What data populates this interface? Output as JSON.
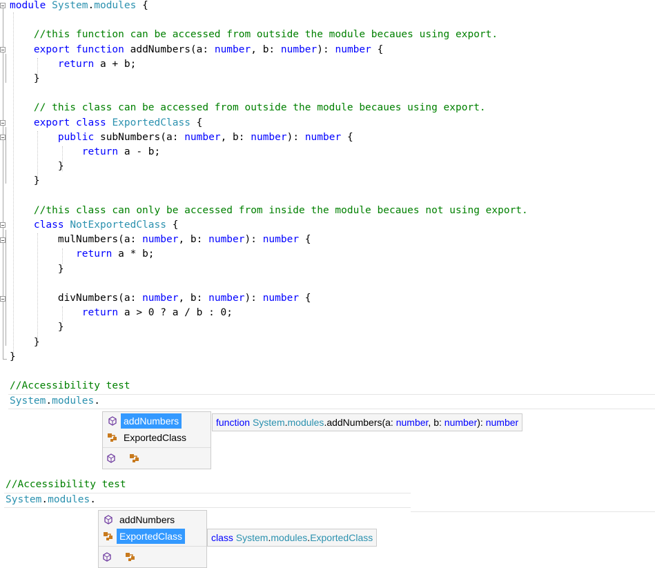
{
  "editor": {
    "lines": [
      [
        {
          "t": "module ",
          "c": "kw"
        },
        {
          "t": "System",
          "c": "ty"
        },
        {
          "t": ".",
          "c": "tx"
        },
        {
          "t": "modules",
          "c": "ty"
        },
        {
          "t": " {",
          "c": "tx"
        }
      ],
      [],
      [
        {
          "t": "    //this function can be accessed from outside the module becaues using export.",
          "c": "cm"
        }
      ],
      [
        {
          "t": "    ",
          "c": "tx"
        },
        {
          "t": "export",
          "c": "kw"
        },
        {
          "t": " ",
          "c": "tx"
        },
        {
          "t": "function",
          "c": "kw"
        },
        {
          "t": " addNumbers(a: ",
          "c": "tx"
        },
        {
          "t": "number",
          "c": "kw"
        },
        {
          "t": ", b: ",
          "c": "tx"
        },
        {
          "t": "number",
          "c": "kw"
        },
        {
          "t": "): ",
          "c": "tx"
        },
        {
          "t": "number",
          "c": "kw"
        },
        {
          "t": " {",
          "c": "tx"
        }
      ],
      [
        {
          "t": "        ",
          "c": "tx"
        },
        {
          "t": "return",
          "c": "kw"
        },
        {
          "t": " a + b;",
          "c": "tx"
        }
      ],
      [
        {
          "t": "    }",
          "c": "tx"
        }
      ],
      [],
      [
        {
          "t": "    // this class can be accessed from outside the module becaues using export.",
          "c": "cm"
        }
      ],
      [
        {
          "t": "    ",
          "c": "tx"
        },
        {
          "t": "export",
          "c": "kw"
        },
        {
          "t": " ",
          "c": "tx"
        },
        {
          "t": "class",
          "c": "kw"
        },
        {
          "t": " ",
          "c": "tx"
        },
        {
          "t": "ExportedClass",
          "c": "ty"
        },
        {
          "t": " {",
          "c": "tx"
        }
      ],
      [
        {
          "t": "        ",
          "c": "tx"
        },
        {
          "t": "public",
          "c": "kw"
        },
        {
          "t": " subNumbers(a: ",
          "c": "tx"
        },
        {
          "t": "number",
          "c": "kw"
        },
        {
          "t": ", b: ",
          "c": "tx"
        },
        {
          "t": "number",
          "c": "kw"
        },
        {
          "t": "): ",
          "c": "tx"
        },
        {
          "t": "number",
          "c": "kw"
        },
        {
          "t": " {",
          "c": "tx"
        }
      ],
      [
        {
          "t": "            ",
          "c": "tx"
        },
        {
          "t": "return",
          "c": "kw"
        },
        {
          "t": " a - b;",
          "c": "tx"
        }
      ],
      [
        {
          "t": "        }",
          "c": "tx"
        }
      ],
      [
        {
          "t": "    }",
          "c": "tx"
        }
      ],
      [],
      [
        {
          "t": "    //this class can only be accessed from inside the module becaues not using export.",
          "c": "cm"
        }
      ],
      [
        {
          "t": "    ",
          "c": "tx"
        },
        {
          "t": "class",
          "c": "kw"
        },
        {
          "t": " ",
          "c": "tx"
        },
        {
          "t": "NotExportedClass",
          "c": "ty"
        },
        {
          "t": " {",
          "c": "tx"
        }
      ],
      [
        {
          "t": "        mulNumbers(a: ",
          "c": "tx"
        },
        {
          "t": "number",
          "c": "kw"
        },
        {
          "t": ", b: ",
          "c": "tx"
        },
        {
          "t": "number",
          "c": "kw"
        },
        {
          "t": "): ",
          "c": "tx"
        },
        {
          "t": "number",
          "c": "kw"
        },
        {
          "t": " {",
          "c": "tx"
        }
      ],
      [
        {
          "t": "           ",
          "c": "tx"
        },
        {
          "t": "return",
          "c": "kw"
        },
        {
          "t": " a * b;",
          "c": "tx"
        }
      ],
      [
        {
          "t": "        }",
          "c": "tx"
        }
      ],
      [],
      [
        {
          "t": "        divNumbers(a: ",
          "c": "tx"
        },
        {
          "t": "number",
          "c": "kw"
        },
        {
          "t": ", b: ",
          "c": "tx"
        },
        {
          "t": "number",
          "c": "kw"
        },
        {
          "t": "): ",
          "c": "tx"
        },
        {
          "t": "number",
          "c": "kw"
        },
        {
          "t": " {",
          "c": "tx"
        }
      ],
      [
        {
          "t": "            ",
          "c": "tx"
        },
        {
          "t": "return",
          "c": "kw"
        },
        {
          "t": " a > 0 ? a / b : 0;",
          "c": "tx"
        }
      ],
      [
        {
          "t": "        }",
          "c": "tx"
        }
      ],
      [
        {
          "t": "    }",
          "c": "tx"
        }
      ],
      [
        {
          "t": "}",
          "c": "tx"
        }
      ]
    ]
  },
  "test1": {
    "comment": "//Accessibility test",
    "code_ns": "System",
    "code_dot1": ".",
    "code_mod": "modules",
    "code_dot2": ".",
    "items": [
      {
        "label": "addNumbers",
        "icon": "function-icon",
        "selected": true
      },
      {
        "label": "ExportedClass",
        "icon": "class-icon",
        "selected": false
      }
    ],
    "tooltip": [
      {
        "t": "function ",
        "c": "kw"
      },
      {
        "t": "System",
        "c": "ty"
      },
      {
        "t": ".",
        "c": "tx"
      },
      {
        "t": "modules",
        "c": "ty"
      },
      {
        "t": ".addNumbers(a: ",
        "c": "tx"
      },
      {
        "t": "number",
        "c": "kw"
      },
      {
        "t": ", b: ",
        "c": "tx"
      },
      {
        "t": "number",
        "c": "kw"
      },
      {
        "t": "): ",
        "c": "tx"
      },
      {
        "t": "number",
        "c": "kw"
      }
    ]
  },
  "test2": {
    "comment": "//Accessibility test",
    "code_ns": "System",
    "code_dot1": ".",
    "code_mod": "modules",
    "code_dot2": ".",
    "items": [
      {
        "label": "addNumbers",
        "icon": "function-icon",
        "selected": false
      },
      {
        "label": "ExportedClass",
        "icon": "class-icon",
        "selected": true
      }
    ],
    "tooltip": [
      {
        "t": "class ",
        "c": "kw"
      },
      {
        "t": "System",
        "c": "ty"
      },
      {
        "t": ".",
        "c": "tx"
      },
      {
        "t": "modules",
        "c": "ty"
      },
      {
        "t": ".",
        "c": "tx"
      },
      {
        "t": "ExportedClass",
        "c": "ty"
      }
    ]
  },
  "colors": {
    "keyword": "#0000ff",
    "type": "#2b91af",
    "comment": "#008000",
    "selection": "#3399ff"
  }
}
